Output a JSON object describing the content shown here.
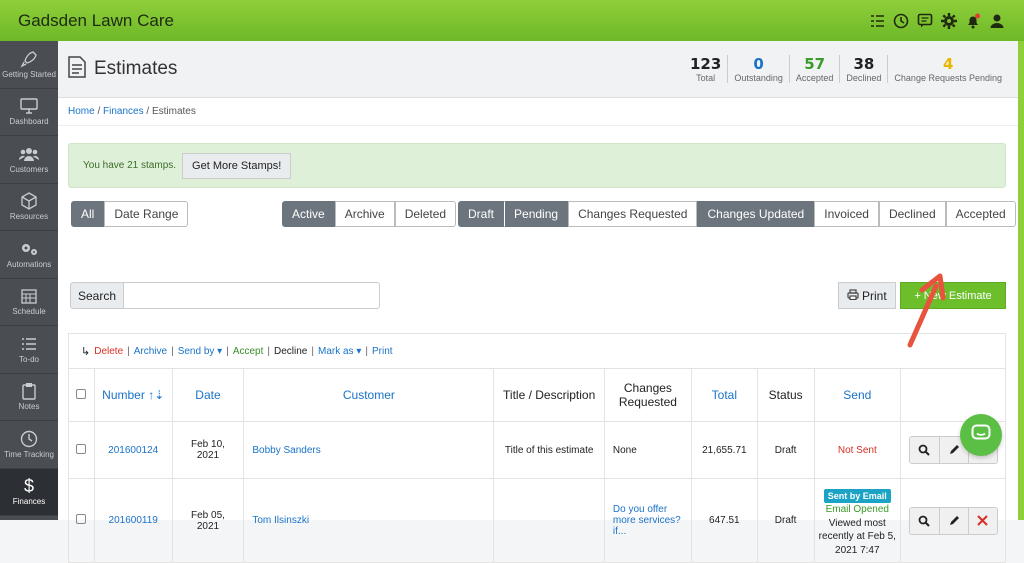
{
  "app": {
    "title": "Gadsden Lawn Care"
  },
  "sidebar": {
    "items": [
      {
        "label": "Getting Started",
        "icon": "rocket-icon"
      },
      {
        "label": "Dashboard",
        "icon": "monitor-icon"
      },
      {
        "label": "Customers",
        "icon": "users-icon"
      },
      {
        "label": "Resources",
        "icon": "cube-icon"
      },
      {
        "label": "Automations",
        "icon": "gears-icon"
      },
      {
        "label": "Schedule",
        "icon": "calendar-icon"
      },
      {
        "label": "To-do",
        "icon": "list-icon"
      },
      {
        "label": "Notes",
        "icon": "clipboard-icon"
      },
      {
        "label": "Time Tracking",
        "icon": "clock-icon"
      },
      {
        "label": "Finances",
        "icon": "dollar-icon"
      }
    ]
  },
  "page": {
    "title": "Estimates"
  },
  "stats": [
    {
      "value": "123",
      "label": "Total",
      "color": "#222222"
    },
    {
      "value": "0",
      "label": "Outstanding",
      "color": "#1a73c8"
    },
    {
      "value": "57",
      "label": "Accepted",
      "color": "#3a9a2a"
    },
    {
      "value": "38",
      "label": "Declined",
      "color": "#222222"
    },
    {
      "value": "4",
      "label": "Change Requests Pending",
      "color": "#e8b800"
    }
  ],
  "breadcrumb": {
    "home": "Home",
    "finances": "Finances",
    "current": "Estimates"
  },
  "alert": {
    "text": "You have 21 stamps.",
    "button": "Get More Stamps!"
  },
  "filters": {
    "all": "All",
    "date_range": "Date Range",
    "active": "Active",
    "archive": "Archive",
    "deleted": "Deleted",
    "draft": "Draft",
    "pending": "Pending",
    "changes_requested": "Changes Requested",
    "changes_updated": "Changes Updated",
    "invoiced": "Invoiced",
    "declined": "Declined",
    "accepted": "Accepted"
  },
  "search": {
    "label": "Search"
  },
  "buttons": {
    "print": "Print",
    "new_estimate": "+ New Estimate"
  },
  "bulk": {
    "delete": "Delete",
    "archive": "Archive",
    "send_by": "Send by",
    "accept": "Accept",
    "decline": "Decline",
    "mark_as": "Mark as",
    "print": "Print"
  },
  "table": {
    "headers": {
      "number": "Number",
      "date": "Date",
      "customer": "Customer",
      "title": "Title / Description",
      "changes": "Changes Requested",
      "total": "Total",
      "status": "Status",
      "send": "Send"
    },
    "rows": [
      {
        "number": "201600124",
        "date": "Feb 10, 2021",
        "customer": "Bobby Sanders",
        "title": "Title of this estimate",
        "changes": "None",
        "total": "21,655.71",
        "status": "Draft",
        "send": "Not Sent"
      },
      {
        "number": "201600119",
        "date": "Feb 05, 2021",
        "customer": "Tom Ilsinszki",
        "title": "",
        "changes": "Do you offer more services? if...",
        "total": "647.51",
        "status": "Draft",
        "send_badge": "Sent by Email",
        "send_opened": "Email Opened",
        "send_viewed": "Viewed most recently at Feb 5, 2021 7:47"
      }
    ]
  }
}
